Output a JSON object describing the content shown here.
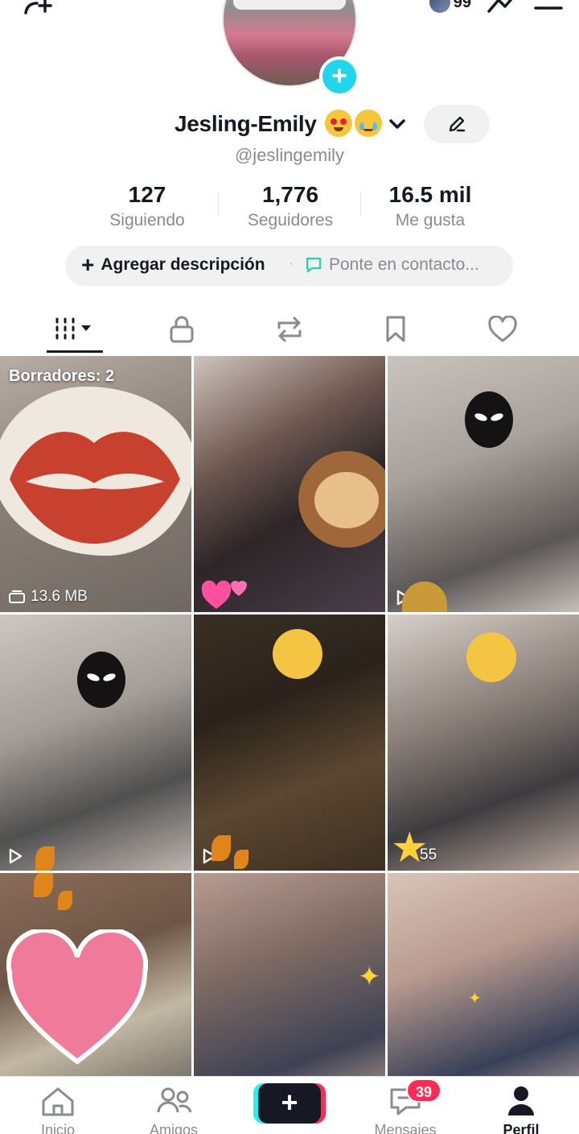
{
  "header": {
    "coin_count": "99"
  },
  "profile": {
    "display_name": "Jesling-Emily",
    "username": "@jeslingemily"
  },
  "stats": [
    {
      "value": "127",
      "label": "Siguiendo"
    },
    {
      "value": "1,776",
      "label": "Seguidores"
    },
    {
      "value": "16.5 mil",
      "label": "Me gusta"
    }
  ],
  "description": {
    "add_label": "Agregar descripción",
    "contact_label": "Ponte en contacto..."
  },
  "tabs": [
    "videos-grid",
    "private",
    "reposts",
    "favorites",
    "liked"
  ],
  "grid": {
    "drafts_label": "Borradores: 2",
    "tiles": [
      {
        "caption": "13.6 MB",
        "icon": "storage-icon"
      },
      {
        "caption": "",
        "icon": "play-icon"
      },
      {
        "caption": "",
        "icon": "play-icon"
      },
      {
        "caption": "",
        "icon": "play-icon"
      },
      {
        "caption": "",
        "icon": "play-icon"
      },
      {
        "caption": "55",
        "icon": "play-icon"
      },
      {
        "caption": "",
        "icon": ""
      },
      {
        "caption": "",
        "icon": ""
      },
      {
        "caption": "",
        "icon": ""
      }
    ]
  },
  "bottom_nav": {
    "home": "Inicio",
    "friends": "Amigos",
    "inbox": "Mensajes",
    "inbox_badge": "39",
    "profile": "Perfil"
  },
  "colors": {
    "accent_cyan": "#20d5ec",
    "accent_red": "#fe2c55",
    "text_primary": "#161823",
    "text_secondary": "#8a8b91"
  }
}
